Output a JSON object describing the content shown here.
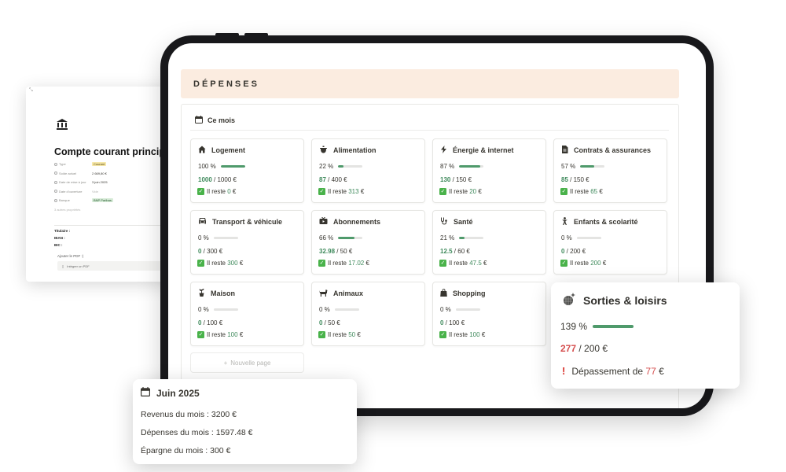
{
  "doc": {
    "corner": "⤡",
    "title": "Compte courant principa",
    "props": [
      {
        "key": "Type",
        "value": "Courant",
        "style": "tag-yellow"
      },
      {
        "key": "Solde actuel",
        "value": "2 669,80 €",
        "style": ""
      },
      {
        "key": "Date de mise à jour",
        "value": "3 juin 2025",
        "style": ""
      },
      {
        "key": "Date d'ouverture",
        "value": "Vide",
        "style": "muted"
      },
      {
        "key": "Banque",
        "value": "BNP Paribas",
        "style": "tag-green"
      }
    ],
    "more": "3 autres propriétés",
    "fields": [
      "Titulaire :",
      "IBAN :",
      "BIC :"
    ],
    "pdf_label": "Ajouter le PDF :)",
    "pdf_button": "Intégrer un PDF"
  },
  "header": {
    "title": "DÉPENSES"
  },
  "view": {
    "label": "Ce mois"
  },
  "cards": [
    {
      "title": "Logement",
      "icon": "house-icon",
      "pct_label": "100 %",
      "pct": 100,
      "spent": "1000",
      "budget": " / 1000 €",
      "remaining_prefix": "Il reste ",
      "remaining": "0",
      "currency": " €"
    },
    {
      "title": "Alimentation",
      "icon": "cooking-pot-icon",
      "pct_label": "22 %",
      "pct": 22,
      "spent": "87",
      "budget": " / 400 €",
      "remaining_prefix": "Il reste ",
      "remaining": "313",
      "currency": " €"
    },
    {
      "title": "Énergie & internet",
      "icon": "lightning-icon",
      "pct_label": "87 %",
      "pct": 87,
      "spent": "130",
      "budget": " / 150 €",
      "remaining_prefix": "Il reste ",
      "remaining": "20",
      "currency": " €"
    },
    {
      "title": "Contrats & assurances",
      "icon": "document-icon",
      "pct_label": "57 %",
      "pct": 57,
      "spent": "85",
      "budget": " / 150 €",
      "remaining_prefix": "Il reste ",
      "remaining": "65",
      "currency": " €"
    },
    {
      "title": "Transport & véhicule",
      "icon": "car-icon",
      "pct_label": "0 %",
      "pct": 0,
      "spent": "0",
      "budget": " / 300 €",
      "remaining_prefix": "Il reste ",
      "remaining": "300",
      "currency": " €"
    },
    {
      "title": "Abonnements",
      "icon": "tv-icon",
      "pct_label": "66 %",
      "pct": 66,
      "spent": "32.98",
      "budget": " / 50 €",
      "remaining_prefix": "Il reste ",
      "remaining": "17.02",
      "currency": " €"
    },
    {
      "title": "Santé",
      "icon": "stethoscope-icon",
      "pct_label": "21 %",
      "pct": 21,
      "spent": "12.5",
      "budget": " / 60 €",
      "remaining_prefix": "Il reste ",
      "remaining": "47.5",
      "currency": " €"
    },
    {
      "title": "Enfants & scolarité",
      "icon": "child-icon",
      "pct_label": "0 %",
      "pct": 0,
      "spent": "0",
      "budget": " / 200 €",
      "remaining_prefix": "Il reste ",
      "remaining": "200",
      "currency": " €"
    },
    {
      "title": "Maison",
      "icon": "plant-pot-icon",
      "pct_label": "0 %",
      "pct": 0,
      "spent": "0",
      "budget": " / 100 €",
      "remaining_prefix": "Il reste ",
      "remaining": "100",
      "currency": " €"
    },
    {
      "title": "Animaux",
      "icon": "dog-icon",
      "pct_label": "0 %",
      "pct": 0,
      "spent": "0",
      "budget": " / 50 €",
      "remaining_prefix": "Il reste ",
      "remaining": "50",
      "currency": " €"
    },
    {
      "title": "Shopping",
      "icon": "shopping-bag-icon",
      "pct_label": "0 %",
      "pct": 0,
      "spent": "0",
      "budget": " / 100 €",
      "remaining_prefix": "Il reste ",
      "remaining": "100",
      "currency": " €"
    }
  ],
  "new_page": {
    "plus": "+",
    "label": "Nouvelle page"
  },
  "sorties": {
    "title": "Sorties & loisirs",
    "icon": "disco-ball-icon",
    "pct_label": "139 %",
    "pct": 139,
    "spent": "277",
    "budget": " / 200 €",
    "excl": "!",
    "over_prefix": "Dépassement de ",
    "over": "77",
    "currency": " €"
  },
  "summary": {
    "title": "Juin 2025",
    "revenus": "Revenus du mois : 3200 €",
    "depenses": "Dépenses du mois : 1597.48 €",
    "epargne": "Épargne du mois : 300 €"
  },
  "colors": {
    "accent_green": "#4f9a6b",
    "over_red": "#d54d4d",
    "header_bg": "#fbece0"
  }
}
